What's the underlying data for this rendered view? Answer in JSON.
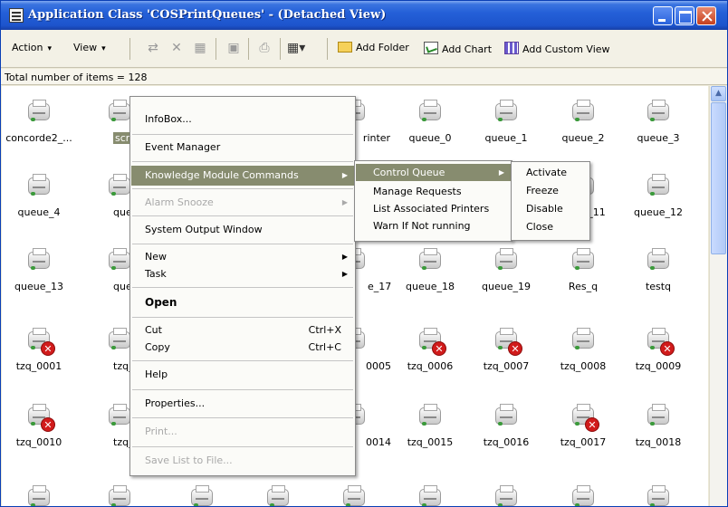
{
  "window": {
    "title": "Application Class 'COSPrintQueues' - (Detached View)"
  },
  "toolbar": {
    "action_label": "Action",
    "view_label": "View",
    "add_folder": "Add Folder",
    "add_chart": "Add Chart",
    "add_custom_view": "Add Custom View"
  },
  "status": {
    "text": "Total number of items = 128"
  },
  "items": {
    "r0": [
      "concorde2_...",
      "scre",
      "",
      "",
      "rinter",
      "queue_0",
      "queue_1",
      "queue_2",
      "queue_3"
    ],
    "r1": [
      "queue_4",
      "queu",
      "",
      "",
      "",
      "",
      "",
      "_11",
      "queue_12"
    ],
    "r2": [
      "queue_13",
      "queu",
      "",
      "",
      "e_17",
      "queue_18",
      "queue_19",
      "Res_q",
      "testq"
    ],
    "r3": [
      "tzq_0001",
      "tzq_",
      "",
      "",
      "0005",
      "tzq_0006",
      "tzq_0007",
      "tzq_0008",
      "tzq_0009"
    ],
    "r4": [
      "tzq_0010",
      "tzq_",
      "",
      "",
      "0014",
      "tzq_0015",
      "tzq_0016",
      "tzq_0017",
      "tzq_0018"
    ]
  },
  "context_menu": {
    "infobox": "InfoBox...",
    "event_manager": "Event Manager",
    "km_commands": "Knowledge Module Commands",
    "alarm_snooze": "Alarm Snooze",
    "system_output": "System Output Window",
    "new": "New",
    "task": "Task",
    "open": "Open",
    "cut": "Cut",
    "cut_shortcut": "Ctrl+X",
    "copy": "Copy",
    "copy_shortcut": "Ctrl+C",
    "help": "Help",
    "properties": "Properties...",
    "print": "Print...",
    "save_list": "Save List to File..."
  },
  "km_submenu": {
    "control_queue": "Control Queue",
    "manage_requests": "Manage Requests",
    "list_printers": "List Associated Printers",
    "warn_not_running": "Warn If Not running"
  },
  "control_submenu": {
    "activate": "Activate",
    "freeze": "Freeze",
    "disable": "Disable",
    "close": "Close"
  },
  "colors": {
    "title_bar": "#2460d8",
    "menu_highlight": "#878c6f",
    "error_badge": "#d11b1b"
  }
}
